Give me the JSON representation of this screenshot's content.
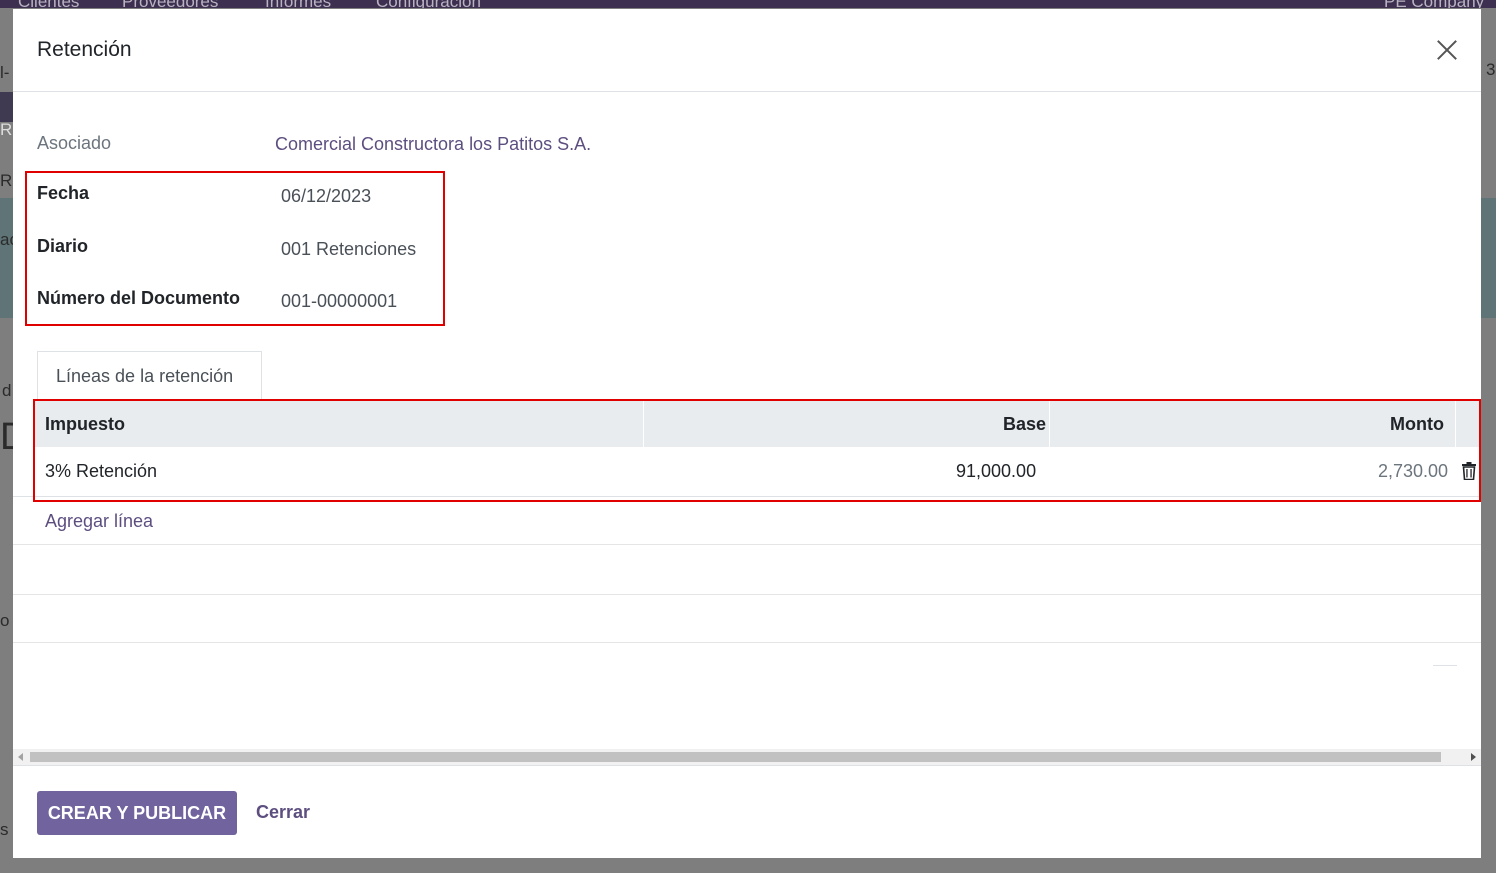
{
  "background": {
    "nav_items": [
      "Clientes",
      "Proveedores",
      "Informes",
      "Configuración"
    ],
    "company": "PE Company",
    "left_chars": [
      "l-",
      "R",
      "RI",
      "ac",
      "d",
      "D",
      "o",
      "s"
    ],
    "right_chars": [
      "3"
    ]
  },
  "modal": {
    "title": "Retención",
    "fields": {
      "asociado_label": "Asociado",
      "asociado_value": "Comercial Constructora los Patitos S.A.",
      "fecha_label": "Fecha",
      "fecha_value": "06/12/2023",
      "diario_label": "Diario",
      "diario_value": "001 Retenciones",
      "numero_label": "Número del Documento",
      "numero_value": "001-00000001"
    },
    "tab_label": "Líneas de la retención",
    "table": {
      "headers": [
        "Impuesto",
        "Base",
        "Monto"
      ],
      "rows": [
        {
          "impuesto": "3% Retención",
          "base": "91,000.00",
          "monto": "2,730.00"
        }
      ],
      "add_line": "Agregar línea"
    },
    "footer": {
      "primary_button": "CREAR Y PUBLICAR",
      "close_link": "Cerrar"
    }
  },
  "colors": {
    "accent": "#71639e",
    "link": "#5d4e80",
    "highlight_box": "#e00000",
    "table_header_bg": "#e9ecef"
  }
}
